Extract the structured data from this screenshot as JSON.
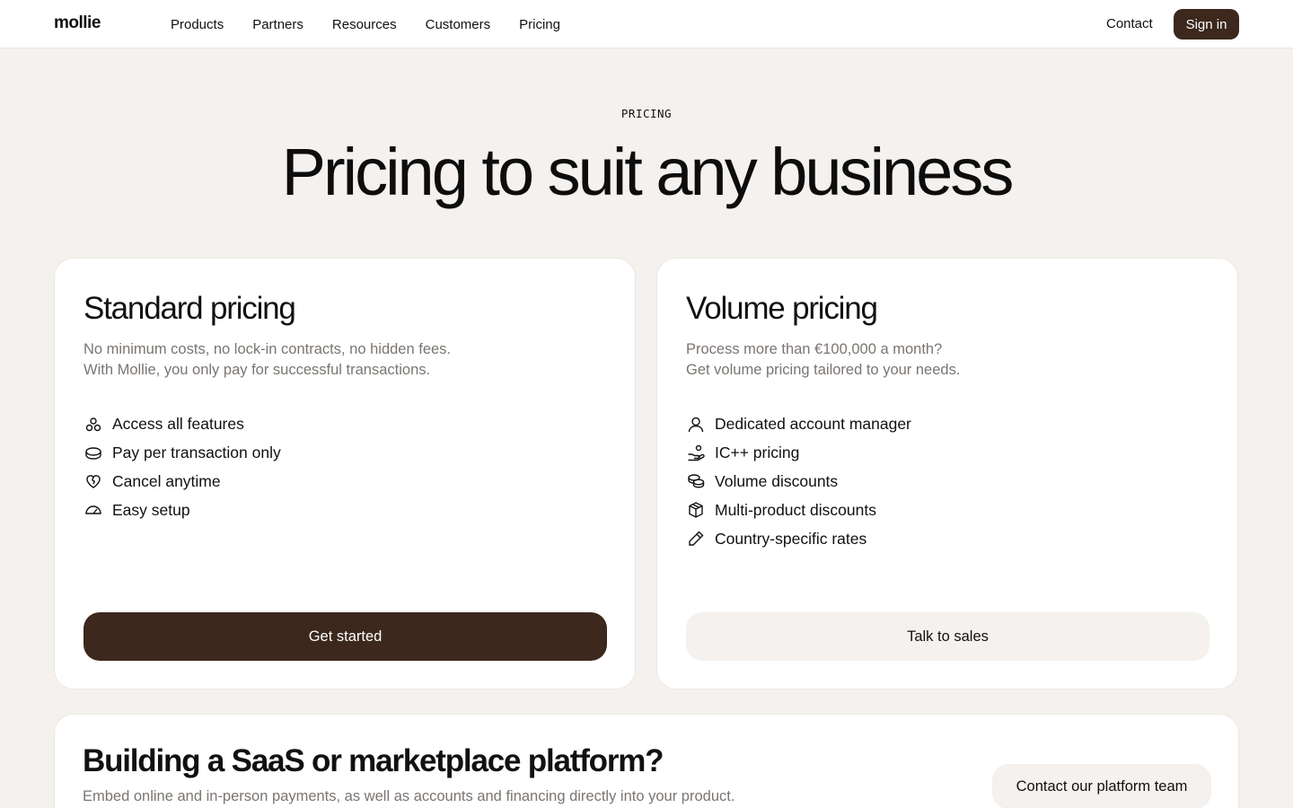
{
  "header": {
    "logo": "mollie",
    "nav": [
      "Products",
      "Partners",
      "Resources",
      "Customers",
      "Pricing"
    ],
    "contact": "Contact",
    "signin": "Sign in"
  },
  "hero": {
    "eyebrow": "PRICING",
    "title": "Pricing to suit any business"
  },
  "standard": {
    "title": "Standard pricing",
    "desc_line1": "No minimum costs, no lock-in contracts, no hidden fees.",
    "desc_line2": "With Mollie, you only pay for successful transactions.",
    "features": [
      {
        "icon": "circles-icon",
        "label": "Access all features"
      },
      {
        "icon": "coin-icon",
        "label": "Pay per transaction only"
      },
      {
        "icon": "heart-icon",
        "label": "Cancel anytime"
      },
      {
        "icon": "gauge-icon",
        "label": "Easy setup"
      }
    ],
    "button": "Get started"
  },
  "volume": {
    "title": "Volume pricing",
    "desc_line1": "Process more than €100,000 a month?",
    "desc_line2": "Get volume pricing tailored to your needs.",
    "features": [
      {
        "icon": "user-icon",
        "label": "Dedicated account manager"
      },
      {
        "icon": "hand-coins-icon",
        "label": "IC++ pricing"
      },
      {
        "icon": "coins-stack-icon",
        "label": "Volume discounts"
      },
      {
        "icon": "box-icon",
        "label": "Multi-product discounts"
      },
      {
        "icon": "pencil-icon",
        "label": "Country-specific rates"
      }
    ],
    "button": "Talk to sales"
  },
  "platform": {
    "title": "Building a SaaS or marketplace platform?",
    "desc": "Embed online and in-person payments, as well as accounts and financing directly into your product.",
    "button": "Contact our platform team"
  },
  "colors": {
    "accent": "#3c281d",
    "background": "#f4f1ee",
    "muted_text": "#7a7571"
  }
}
